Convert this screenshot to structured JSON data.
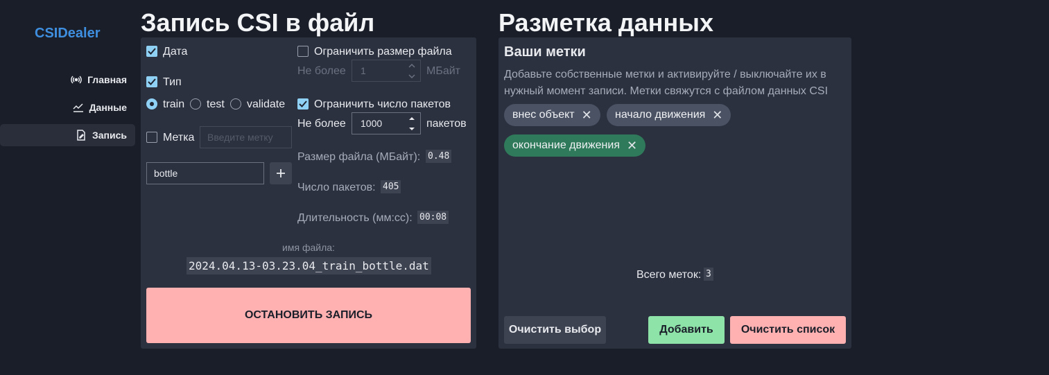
{
  "app": {
    "title": "CSIDealer"
  },
  "nav": [
    {
      "label": "Главная",
      "icon": "broadcast-icon"
    },
    {
      "label": "Данные",
      "icon": "chart-icon"
    },
    {
      "label": "Запись",
      "icon": "file-edit-icon",
      "active": true
    }
  ],
  "record": {
    "title": "Запись CSI в файл",
    "date_label": "Дата",
    "type_label": "Тип",
    "types": [
      "train",
      "test",
      "validate"
    ],
    "selected_type": "train",
    "tag_label": "Метка",
    "tag_placeholder": "Введите метку",
    "tag_value": "bottle",
    "limit_size_label": "Ограничить размер файла",
    "size_prefix": "Не более",
    "size_value": "1",
    "size_unit": "МБайт",
    "limit_packets_label": "Ограничить число пакетов",
    "packets_prefix": "Не более",
    "packets_value": "1000",
    "packets_unit": "пакетов",
    "file_size_label": "Размер файла (МБайт):",
    "file_size_value": "0.48",
    "packet_count_label": "Число пакетов:",
    "packet_count_value": "405",
    "duration_label": "Длительность (мм:сс):",
    "duration_value": "00:08",
    "filename_caption": "имя файла:",
    "filename": "2024.04.13-03.23.04_train_bottle.dat",
    "stop_label": "ОСТАНОВИТЬ ЗАПИСЬ"
  },
  "markup": {
    "title": "Разметка данных",
    "card_title": "Ваши метки",
    "description": "Добавьте собственные метки и активируйте / выключайте их в нужный момент записи. Метки свяжутся с файлом данных CSI",
    "chips": [
      {
        "label": "внес объект",
        "active": false
      },
      {
        "label": "начало движения",
        "active": false
      },
      {
        "label": "окончание движения",
        "active": true
      }
    ],
    "total_label": "Всего меток:",
    "total_value": "3",
    "clear_selection_label": "Очистить выбор",
    "add_label": "Добавить",
    "clear_list_label": "Очистить список"
  },
  "colors": {
    "accent": "#3f8fe0",
    "checkbox": "#8fd0f5",
    "stop": "#ffb1b1",
    "add": "#8ee3a8",
    "chip_active": "#2f7a5a",
    "chip": "#4a5263"
  }
}
